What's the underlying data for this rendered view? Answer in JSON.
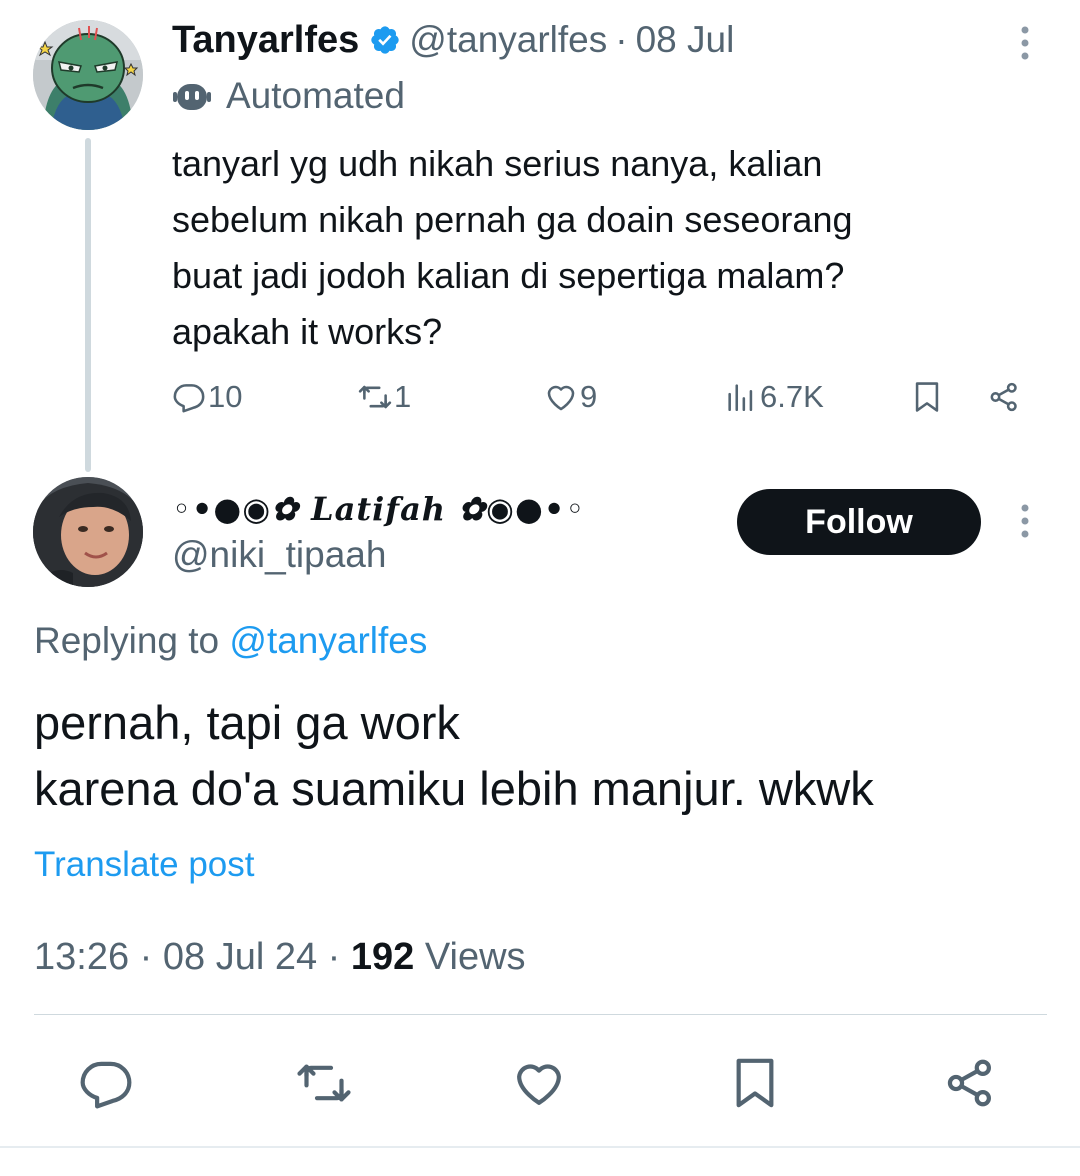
{
  "colors": {
    "text_primary": "#0f1419",
    "text_secondary": "#536471",
    "accent": "#1d9bf0",
    "follow_bg": "#0f1419",
    "divider": "#cfd9de"
  },
  "parent_tweet": {
    "display_name": "Tanyarlfes",
    "verified_icon": "verified-badge-icon",
    "handle": "@tanyarlfes",
    "separator": "·",
    "date": "08 Jul",
    "automated_icon": "bot-icon",
    "automated_label": "Automated",
    "text_lines": [
      "tanyarl yg udh nikah serius nanya, kalian",
      "sebelum nikah pernah ga doain seseorang",
      "buat jadi jodoh kalian di sepertiga malam?",
      "apakah it works?"
    ],
    "actions": {
      "replies": "10",
      "reposts": "1",
      "likes": "9",
      "views": "6.7K"
    }
  },
  "reply_tweet": {
    "display_name": "◦•●◉✿ Latifah ✿◉●•◦",
    "handle": "@niki_tipaah",
    "follow_label": "Follow",
    "replying_prefix": "Replying to",
    "replying_to": "@tanyarlfes",
    "text_lines": [
      "pernah, tapi ga work",
      "karena do'a suamiku lebih manjur. wkwk"
    ],
    "translate_label": "Translate post",
    "time": "13:26",
    "separator": "·",
    "date": "08 Jul 24",
    "views_count": "192",
    "views_label": "Views"
  }
}
